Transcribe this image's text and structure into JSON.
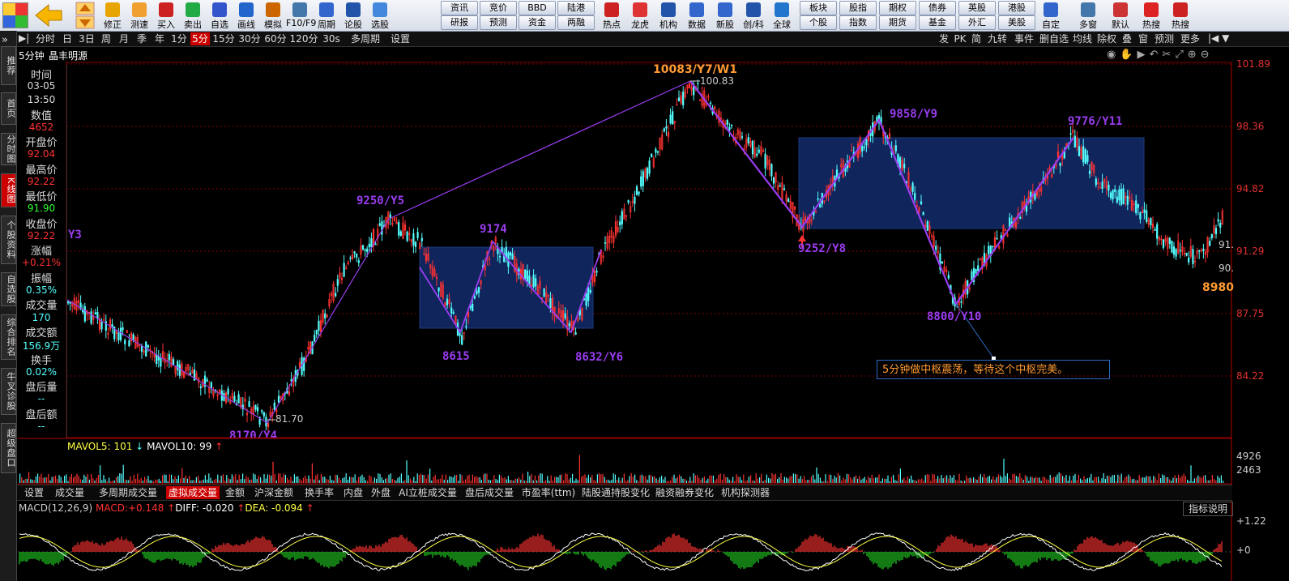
{
  "toolbar": {
    "items": [
      {
        "label": "修正",
        "icon": "pencil-icon"
      },
      {
        "label": "测速",
        "icon": "clock-icon"
      },
      {
        "label": "买入",
        "icon": "buy-icon"
      },
      {
        "label": "卖出",
        "icon": "sell-icon"
      },
      {
        "label": "自选",
        "icon": "star-icon"
      },
      {
        "label": "画线",
        "icon": "draw-icon"
      },
      {
        "label": "模拟",
        "icon": "hammer-icon"
      },
      {
        "label": "F10/F9",
        "icon": "f10-icon"
      },
      {
        "label": "周期",
        "icon": "clock-icon"
      },
      {
        "label": "论股",
        "icon": "chat-icon"
      },
      {
        "label": "选股",
        "icon": "select-icon"
      }
    ],
    "buttons_top": [
      "资讯",
      "竞价",
      "BBD",
      "陆港"
    ],
    "buttons_bottom": [
      "研报",
      "预测",
      "资金",
      "两融"
    ],
    "items2": [
      {
        "label": "热点",
        "icon": "hot-icon"
      },
      {
        "label": "龙虎",
        "icon": "dragon-icon"
      },
      {
        "label": "机构",
        "icon": "building-icon"
      },
      {
        "label": "数据",
        "icon": "pe-icon"
      },
      {
        "label": "新股",
        "icon": "new-icon"
      },
      {
        "label": "创/科",
        "icon": "chuang-icon"
      },
      {
        "label": "全球",
        "icon": "globe-icon"
      }
    ],
    "buttons2_top": [
      "板块",
      "股指",
      "期权",
      "债券",
      "英股",
      "港股"
    ],
    "buttons2_bottom": [
      "个股",
      "指数",
      "期货",
      "基金",
      "外汇",
      "美股"
    ],
    "items3": [
      {
        "label": "自定",
        "icon": "grid-icon"
      },
      {
        "label": "多窗",
        "icon": "windows-icon"
      },
      {
        "label": "默认",
        "icon": "home-icon"
      },
      {
        "label": "热搜",
        "icon": "fire-icon"
      },
      {
        "label": "热搜",
        "icon": "shield-icon"
      }
    ]
  },
  "sidebar": {
    "tabs": [
      "推荐",
      "首页",
      "分时图",
      "K线图",
      "个股资料",
      "自选股",
      "综合排名",
      "牛叉诊股",
      "超级盘口"
    ],
    "active": "K线图"
  },
  "periodbar": {
    "items": [
      "分时",
      "日",
      "3日",
      "周",
      "月",
      "季",
      "年",
      "1分",
      "5分",
      "15分",
      "30分",
      "60分",
      "120分",
      "30s",
      "多周期",
      "设置"
    ],
    "active": "5分",
    "right": [
      "发",
      "PK",
      "简",
      "九转",
      "事件",
      "删自选",
      "均线",
      "除权",
      "叠",
      "窗",
      "预测",
      "更多"
    ]
  },
  "chart_header": {
    "period": "5分钟",
    "stock": "晶丰明源"
  },
  "info": {
    "time_label": "时间",
    "date": "03-05",
    "time": "13:50",
    "value_label": "数值",
    "value": "4652",
    "open_label": "开盘价",
    "open": "92.04",
    "high_label": "最高价",
    "high": "92.22",
    "low_label": "最低价",
    "low": "91.90",
    "close_label": "收盘价",
    "close": "92.22",
    "chg_label": "涨幅",
    "chg": "+0.21%",
    "amp_label": "振幅",
    "amp": "0.35%",
    "vol_label": "成交量",
    "vol": "170",
    "amt_label": "成交额",
    "amt": "156.9万",
    "turn_label": "换手",
    "turn": "0.02%",
    "postvol_label": "盘后量",
    "postvol": "--",
    "postamt_label": "盘后额",
    "postamt": "--"
  },
  "price_axis": [
    "101.89",
    "98.36",
    "94.82",
    "91.29",
    "87.75",
    "84.22"
  ],
  "annotations": {
    "top": "10083/Y7/W1",
    "top_price": "100.83",
    "p9250": "9250/Y5",
    "p9174": "9174",
    "p8615": "8615",
    "p8632": "8632/Y6",
    "p9858": "9858/Y9",
    "p9252": "9252/Y8",
    "p8800": "8800/Y10",
    "p9776": "9776/Y11",
    "p8980": "8980",
    "p8170": "8170/Y4",
    "low_price": "81.70",
    "left_y3": "Y3",
    "r1": "91.",
    "r2": "90.",
    "note": "5分钟做中枢震荡，等待这个中枢完美。"
  },
  "volume": {
    "mavol5_label": "MAVOL5:",
    "mavol5": "101",
    "mavol10_label": "MAVOL10:",
    "mavol10": "99",
    "axis": [
      "4926",
      "2463"
    ]
  },
  "voltabs": {
    "items": [
      "设置",
      "成交量",
      "多周期成交量",
      "虚拟成交量",
      "金额",
      "沪深金额",
      "换手率",
      "内盘",
      "外盘",
      "AI立桩成交量",
      "盘后成交量",
      "市盈率(ttm)",
      "陆股通持股变化",
      "融资融券变化",
      "机构探测器"
    ],
    "active": "虚拟成交量"
  },
  "macd": {
    "title": "MACD(12,26,9)",
    "macd_label": "MACD:",
    "macd": "+0.148",
    "diff_label": "DIFF:",
    "diff": "-0.020",
    "dea_label": "DEA:",
    "dea": "-0.094",
    "help": "指标说明",
    "axis": [
      "+1.22",
      "+0"
    ]
  },
  "colors": {
    "up": "#ff3232",
    "down": "#54ffff",
    "pivot": "#9a3df0",
    "box": "#10255c",
    "grid": "#7a0000"
  }
}
